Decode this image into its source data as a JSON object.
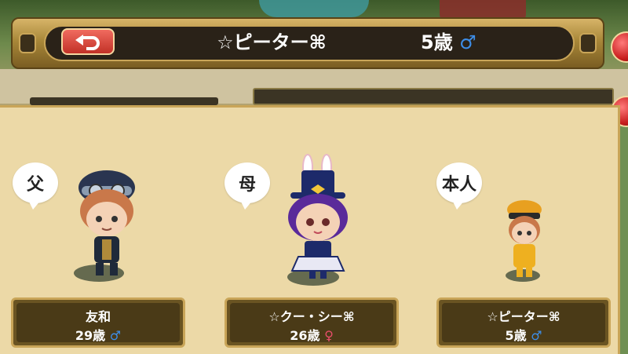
{
  "header": {
    "name": "☆ピーター⌘",
    "age": "5歳",
    "gender_symbol": "♂"
  },
  "family": [
    {
      "relation": "父",
      "name": "友和",
      "age": "29歳",
      "gender_symbol": "♂",
      "gender": "male"
    },
    {
      "relation": "母",
      "name": "☆クー・シー⌘",
      "age": "26歳",
      "gender_symbol": "♀",
      "gender": "female"
    },
    {
      "relation": "本人",
      "name": "☆ピーター⌘",
      "age": "5歳",
      "gender_symbol": "♂",
      "gender": "male"
    }
  ],
  "colors": {
    "panel": "#ecd9a7",
    "gold_border": "#c9a558",
    "card": "#4a3a17",
    "male": "#3d8ee8",
    "female": "#e84d6b",
    "back_button": "#d9463a"
  },
  "icons": {
    "back": "back-arrow-icon"
  }
}
